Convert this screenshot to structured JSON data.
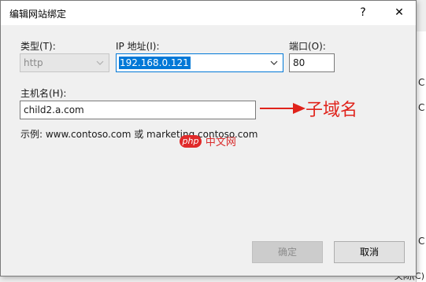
{
  "dialog": {
    "title": "编辑网站绑定",
    "help_glyph": "?",
    "close_glyph": "✕"
  },
  "type_field": {
    "label": "类型(T):",
    "value": "http"
  },
  "ip_field": {
    "label": "IP 地址(I):",
    "value": "192.168.0.121"
  },
  "port_field": {
    "label": "端口(O):",
    "value": "80"
  },
  "host_field": {
    "label": "主机名(H):",
    "value": "child2.a.com"
  },
  "example_text": "示例: www.contoso.com 或 marketing.contoso.com",
  "annotation": {
    "text": "子域名",
    "color": "#e0231b"
  },
  "watermark": {
    "logo": "php",
    "text": "中文网"
  },
  "buttons": {
    "ok": "确定",
    "cancel": "取消"
  },
  "background": {
    "fragment_1": "C",
    "fragment_2": "C",
    "fragment_3": "C",
    "bottom_text": "关闭(C)"
  },
  "colors": {
    "selection": "#0078d7",
    "annotation": "#e0231b"
  }
}
